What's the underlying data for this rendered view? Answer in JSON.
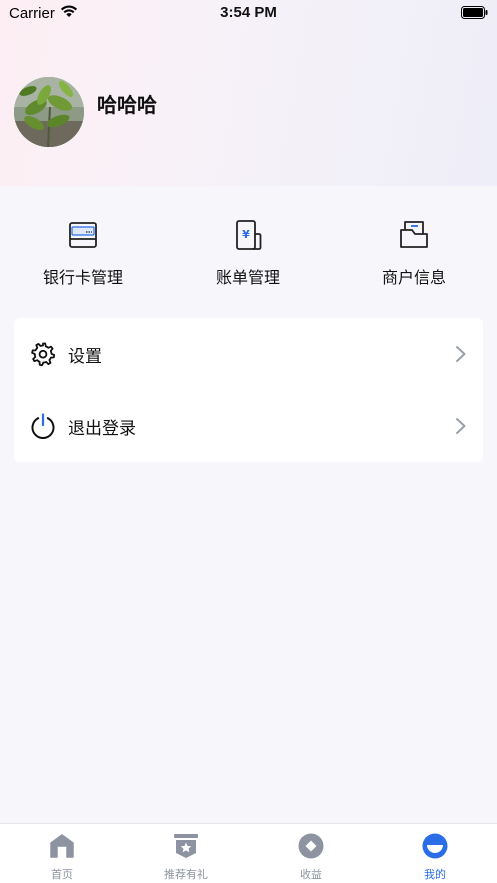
{
  "status_bar": {
    "carrier": "Carrier",
    "time": "3:54 PM"
  },
  "profile": {
    "username": "哈哈哈"
  },
  "quick_actions": [
    {
      "label": "银行卡管理",
      "icon": "bank-card-icon"
    },
    {
      "label": "账单管理",
      "icon": "bill-icon"
    },
    {
      "label": "商户信息",
      "icon": "merchant-folder-icon"
    }
  ],
  "menu": [
    {
      "label": "设置",
      "icon": "gear-icon"
    },
    {
      "label": "退出登录",
      "icon": "power-icon"
    }
  ],
  "tabbar": {
    "items": [
      {
        "label": "首页",
        "icon": "home-icon",
        "active": false
      },
      {
        "label": "推荐有礼",
        "icon": "gift-star-icon",
        "active": false
      },
      {
        "label": "收益",
        "icon": "earnings-icon",
        "active": false
      },
      {
        "label": "我的",
        "icon": "profile-icon",
        "active": true
      }
    ],
    "active_color": "#2a6de6",
    "inactive_color": "#8d93a0"
  },
  "colors": {
    "accent": "#2a6de6",
    "background": "#f7f7fb"
  }
}
